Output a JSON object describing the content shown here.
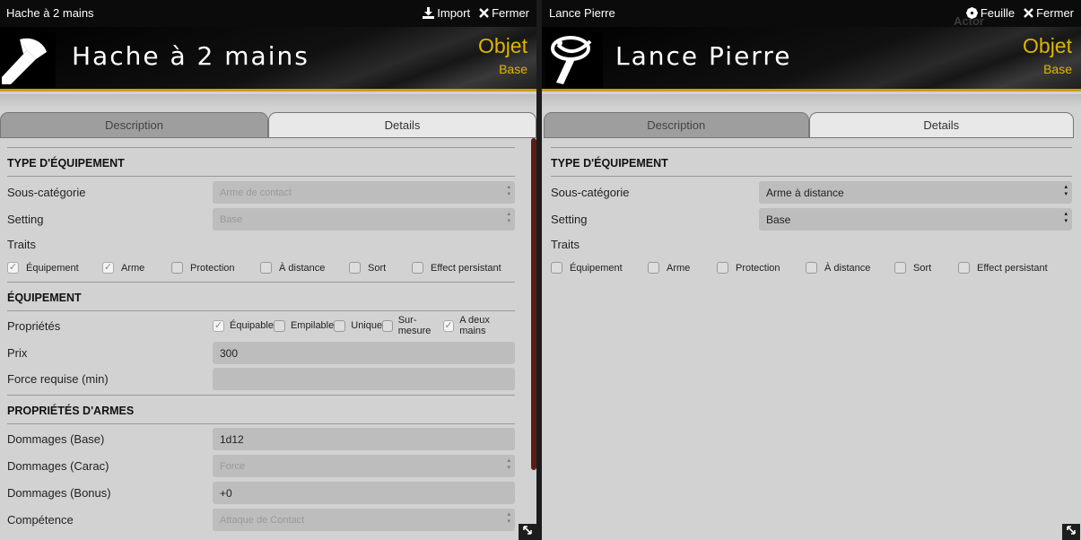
{
  "left": {
    "title": "Hache à 2 mains",
    "actions": {
      "import": "Import",
      "close": "Fermer"
    },
    "name": "Hache à 2 mains",
    "type": "Objet",
    "subtype": "Base",
    "tabs": [
      "Description",
      "Details"
    ],
    "section_equipment_type": "TYPE D'ÉQUIPEMENT",
    "subcat_label": "Sous-catégorie",
    "subcat_value": "Arme de contact",
    "setting_label": "Setting",
    "setting_value": "Base",
    "traits_label": "Traits",
    "traits": [
      {
        "label": "Équipement",
        "checked": true
      },
      {
        "label": "Arme",
        "checked": true
      },
      {
        "label": "Protection",
        "checked": false
      },
      {
        "label": "À distance",
        "checked": false
      },
      {
        "label": "Sort",
        "checked": false
      },
      {
        "label": "Effect persistant",
        "checked": false
      }
    ],
    "section_equipment": "ÉQUIPEMENT",
    "props_label": "Propriétés",
    "props": [
      {
        "label": "Équipable",
        "checked": true
      },
      {
        "label": "Empilable",
        "checked": false
      },
      {
        "label": "Unique",
        "checked": false
      },
      {
        "label": "Sur-mesure",
        "checked": false
      },
      {
        "label": "A deux mains",
        "checked": true
      }
    ],
    "price_label": "Prix",
    "price_value": "300",
    "strength_label": "Force requise (min)",
    "strength_value": "",
    "section_weapon": "PROPRIÉTÉS D'ARMES",
    "dmg_base_label": "Dommages (Base)",
    "dmg_base_value": "1d12",
    "dmg_carac_label": "Dommages (Carac)",
    "dmg_carac_value": "Force",
    "dmg_bonus_label": "Dommages (Bonus)",
    "dmg_bonus_value": "+0",
    "skill_label": "Compétence",
    "skill_value": "Attaque de Contact"
  },
  "right": {
    "title": "Lance Pierre",
    "actions": {
      "sheet": "Feuille",
      "close": "Fermer"
    },
    "ghost": "Actor",
    "name": "Lance Pierre",
    "type": "Objet",
    "subtype": "Base",
    "tabs": [
      "Description",
      "Details"
    ],
    "section_equipment_type": "TYPE D'ÉQUIPEMENT",
    "subcat_label": "Sous-catégorie",
    "subcat_value": "Arme à distance",
    "setting_label": "Setting",
    "setting_value": "Base",
    "traits_label": "Traits",
    "traits": [
      {
        "label": "Équipement",
        "checked": false
      },
      {
        "label": "Arme",
        "checked": false
      },
      {
        "label": "Protection",
        "checked": false
      },
      {
        "label": "À distance",
        "checked": false
      },
      {
        "label": "Sort",
        "checked": false
      },
      {
        "label": "Effect persistant",
        "checked": false
      }
    ]
  },
  "colors": {
    "accent": "#e0b400",
    "panel_bg": "#d2d2d2",
    "header_bg": "#0b0b0b"
  },
  "icons": {
    "import": "download-icon",
    "close": "close-icon",
    "sheet": "gear-icon",
    "resize": "resize-icon"
  }
}
